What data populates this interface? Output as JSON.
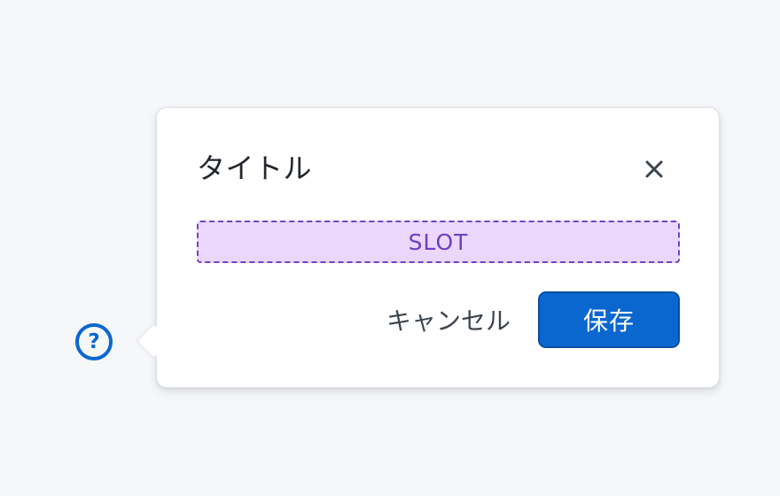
{
  "help": {
    "glyph": "?",
    "icon": "question-circle-icon"
  },
  "popover": {
    "title": "タイトル",
    "close_icon": "close-icon",
    "slot_label": "SLOT",
    "cancel_label": "キャンセル",
    "save_label": "保存"
  },
  "colors": {
    "background": "#f6f7f9",
    "primary": "#0b67d0",
    "slot_fill": "#ead7fb",
    "slot_border": "#6f44c4",
    "text": "#22262d"
  }
}
